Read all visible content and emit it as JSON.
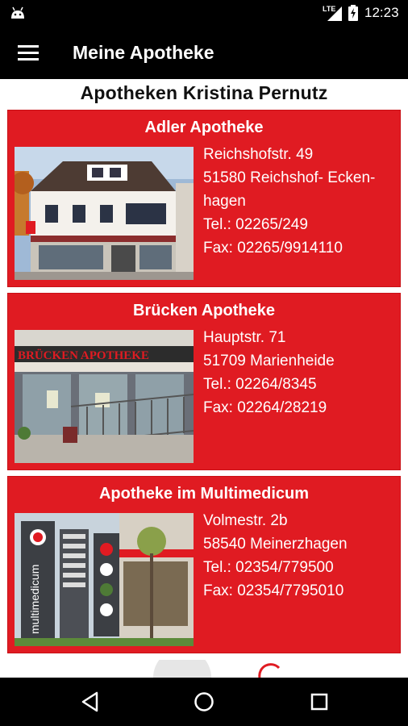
{
  "status_bar": {
    "time": "12:23",
    "network": "LTE",
    "icons": [
      "android-icon",
      "signal-icon",
      "battery-charging-icon"
    ]
  },
  "app_bar": {
    "title": "Meine Apotheke",
    "menu_icon": "hamburger-menu-icon"
  },
  "heading": "Apotheken Kristina Pernutz",
  "colors": {
    "card_red": "#e01b22",
    "bar_black": "#000000",
    "text_white": "#ffffff"
  },
  "pharmacies": [
    {
      "name": "Adler Apotheke",
      "street": "Reichshofstr. 49",
      "city_line1": "51580 Reichshof- Ecken-",
      "city_line2": "hagen",
      "tel": "Tel.: 02265/249",
      "fax": "Fax: 02265/9914110"
    },
    {
      "name": "Brücken Apotheke",
      "street": "Hauptstr. 71",
      "city_line1": "51709 Marienheide",
      "tel": "Tel.: 02264/8345",
      "fax": "Fax: 02264/28219",
      "photo_sign": "BRÜCKEN APOTHEKE"
    },
    {
      "name": "Apotheke im Multimedicum",
      "street": "Volmestr. 2b",
      "city_line1": "58540 Meinerzhagen",
      "tel": "Tel.: 02354/779500",
      "fax": "Fax: 02354/7795010",
      "photo_sign": "multimedicum"
    }
  ],
  "nav_bar": {
    "icons": [
      "back-triangle-icon",
      "home-circle-icon",
      "recents-square-icon"
    ]
  }
}
